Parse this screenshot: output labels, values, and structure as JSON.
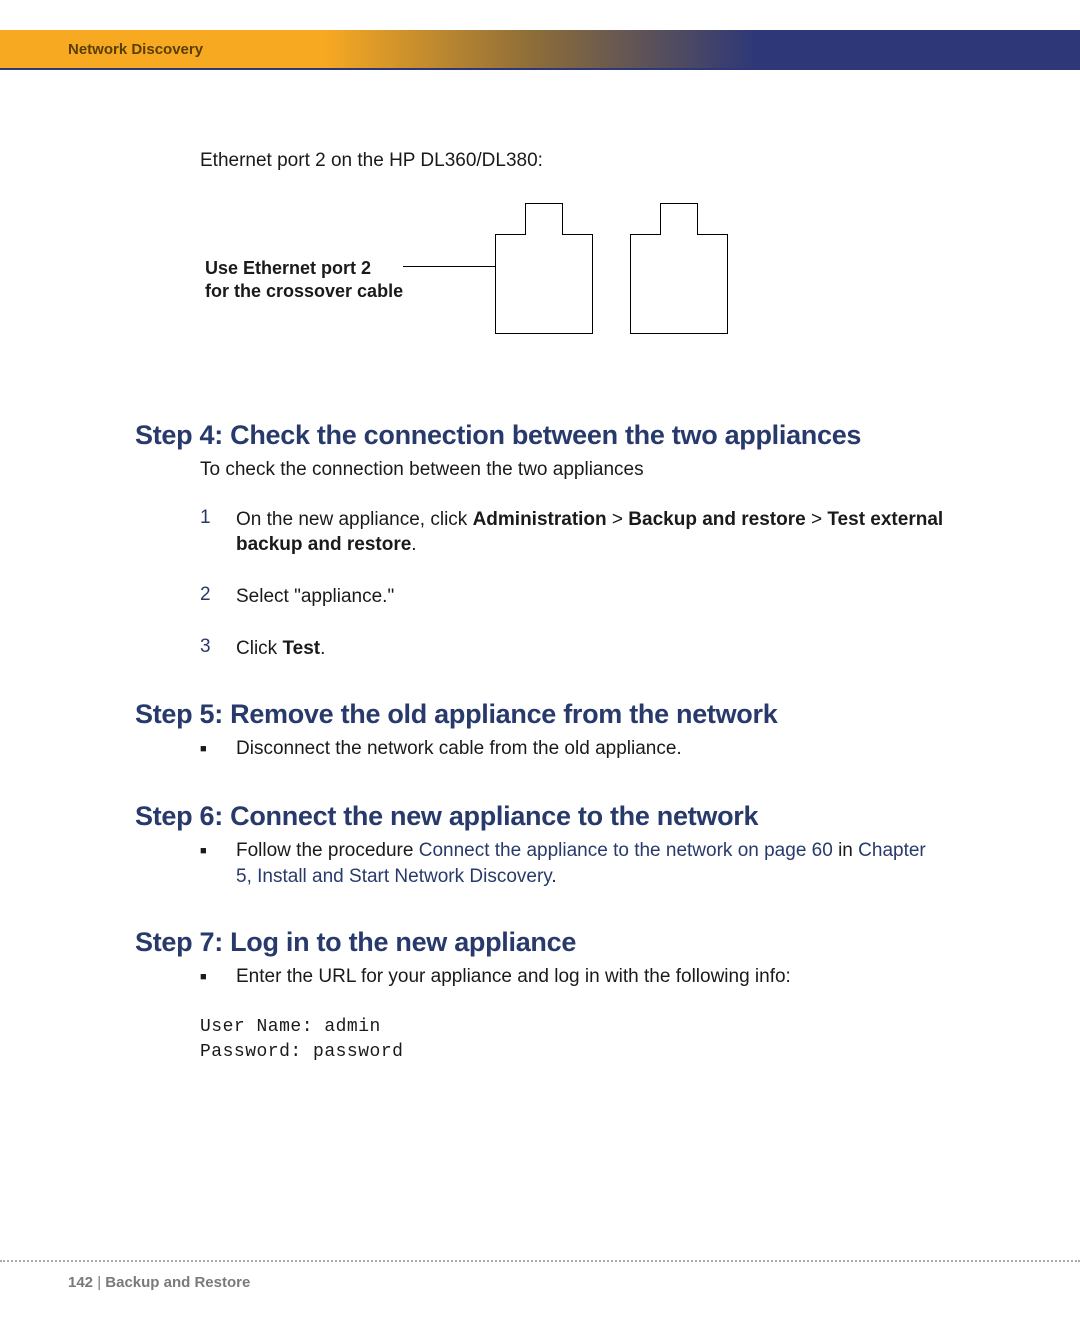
{
  "header": {
    "title": "Network Discovery"
  },
  "intro": "Ethernet port 2 on the HP DL360/DL380:",
  "diagram": {
    "label_line1": "Use Ethernet port 2",
    "label_line2": "for the crossover cable"
  },
  "step4": {
    "heading": "Step 4: Check the connection between the two appliances",
    "para": "To check the connection between the two appliances",
    "items": [
      {
        "n": "1",
        "pre": "On the new appliance, click ",
        "b1": "Administration",
        "s1": " > ",
        "b2": "Backup and restore",
        "s2": " > ",
        "b3": "Test external backup and restore",
        "post": "."
      },
      {
        "n": "2",
        "text": "Select \"appliance.\""
      },
      {
        "n": "3",
        "pre": "Click ",
        "b1": "Test",
        "post": "."
      }
    ]
  },
  "step5": {
    "heading": "Step 5: Remove the old appliance from the network",
    "bullets": [
      {
        "text": "Disconnect the network cable from the old appliance."
      }
    ]
  },
  "step6": {
    "heading": "Step 6: Connect the new appliance to the network",
    "bullets": [
      {
        "pre": "Follow the procedure ",
        "link1": "Connect the appliance to the network on page 60",
        "mid": " in ",
        "link2": "Chapter 5, Install and Start Network Discovery",
        "post": "."
      }
    ]
  },
  "step7": {
    "heading": "Step 7: Log in to the new appliance",
    "bullets": [
      {
        "text": "Enter the URL for your appliance and log in with the following info:"
      }
    ],
    "mono": {
      "l1": "User Name: admin",
      "l2": "Password: password"
    }
  },
  "footer": {
    "page": "142",
    "sep": " | ",
    "chapter": "Backup and Restore"
  }
}
